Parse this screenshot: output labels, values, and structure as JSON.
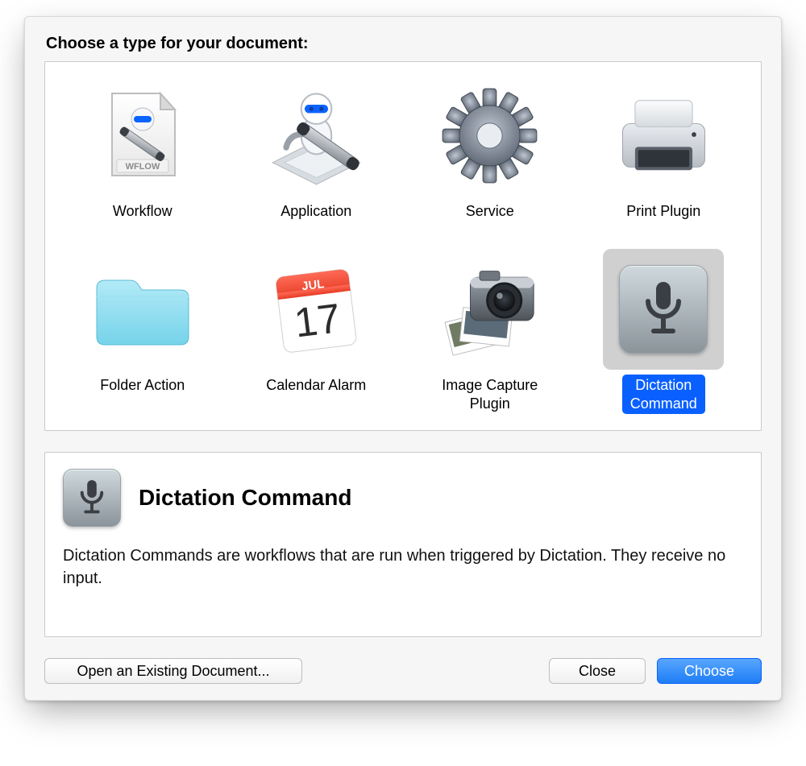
{
  "header": {
    "title": "Choose a type for your document:"
  },
  "types": [
    {
      "id": "workflow",
      "label": "Workflow",
      "selected": false
    },
    {
      "id": "app",
      "label": "Application",
      "selected": false
    },
    {
      "id": "service",
      "label": "Service",
      "selected": false
    },
    {
      "id": "print",
      "label": "Print Plugin",
      "selected": false
    },
    {
      "id": "folder",
      "label": "Folder Action",
      "selected": false
    },
    {
      "id": "calendar",
      "label": "Calendar Alarm",
      "selected": false
    },
    {
      "id": "imagecapture",
      "label": "Image Capture\nPlugin",
      "selected": false
    },
    {
      "id": "dictation",
      "label": "Dictation\nCommand",
      "selected": true
    }
  ],
  "calendar": {
    "month": "JUL",
    "day": "17"
  },
  "workflow_badge": "WFLOW",
  "detail": {
    "title": "Dictation Command",
    "description": "Dictation Commands are workflows that are run when triggered by Dictation. They receive no input."
  },
  "footer": {
    "open": "Open an Existing Document...",
    "close": "Close",
    "choose": "Choose"
  }
}
